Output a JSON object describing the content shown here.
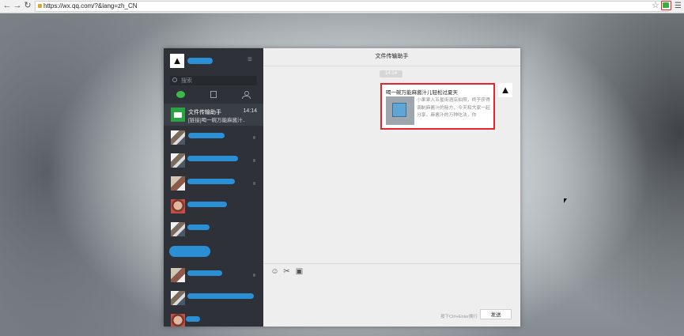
{
  "browser": {
    "url": "https://wx.qq.com/?&lang=zh_CN",
    "back_icon": "arrow-left-icon",
    "forward_icon": "arrow-right-icon",
    "reload_icon": "reload-icon",
    "ext_color": "#35b140",
    "highlight_color": "#e3262a"
  },
  "sidebar": {
    "search_placeholder": "搜索",
    "tabs": [
      "chat-icon",
      "contacts-icon",
      "add-contact-icon"
    ],
    "chats": [
      {
        "title": "文件传输助手",
        "time": "14:14",
        "preview": "[链接]喝一碗万能麻酱汁…"
      }
    ]
  },
  "chat": {
    "title": "文件传输助手",
    "time_badge": "14:14",
    "message": {
      "title": "喝一碗万能麻酱汁儿轻松过夏天",
      "desc": "小果果入五星街酒店拍照，终于获得调制麻酱汁的秘方，今天和大家一起分享。麻酱汁的万种吃法，你"
    },
    "tools": [
      "emoji-icon",
      "screenshot-icon",
      "folder-icon"
    ],
    "hint": "按下Ctrl+Enter换行",
    "send_label": "发送"
  }
}
